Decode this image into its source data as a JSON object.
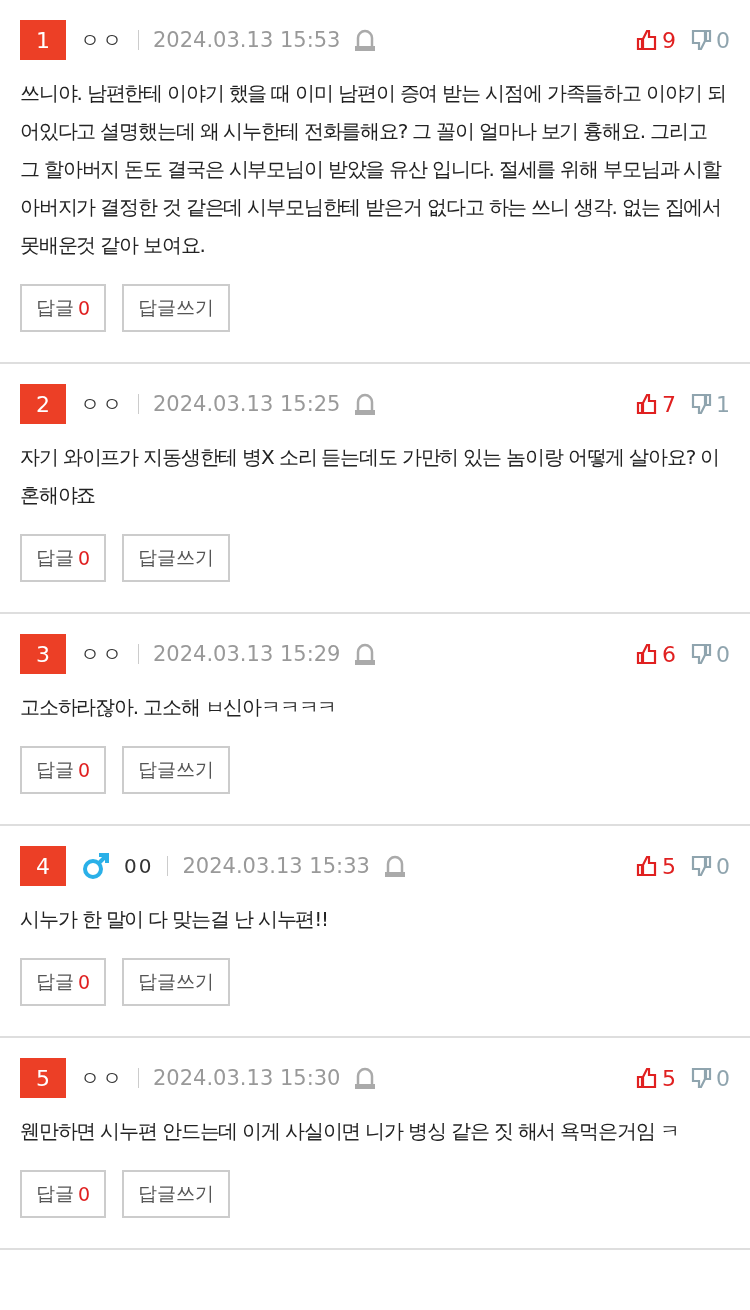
{
  "comments": [
    {
      "rank": "1",
      "author": "ㅇㅇ",
      "kind": "plain",
      "date": "2024.03.13 15:53",
      "likes": "9",
      "dislikes": "0",
      "body": "쓰니야. 남편한테 이야기 했을 때 이미 남편이 증여 받는 시점에 가족들하고 이야기 되어있다고 셜명했는데 왜 시누한테 전화를해요? 그 꼴이 얼마나 보기 흉해요. 그리고 그 할아버지 돈도 결국은 시부모님이 받았을 유산 입니다. 절세를 위해 부모님과 시할아버지가 결정한 것 같은데 시부모님한테 받은거 없다고 하는 쓰니 생각. 없는 집에서 못배운것 같아 보여요.",
      "reply_label": "답글",
      "reply_count": "0",
      "write_label": "답글쓰기"
    },
    {
      "rank": "2",
      "author": "ㅇㅇ",
      "kind": "plain",
      "date": "2024.03.13 15:25",
      "likes": "7",
      "dislikes": "1",
      "body": "자기 와이프가 지동생한테 병X 소리 듣는데도 가만히 있는 놈이랑 어떻게 살아요? 이혼해야죠",
      "reply_label": "답글",
      "reply_count": "0",
      "write_label": "답글쓰기"
    },
    {
      "rank": "3",
      "author": "ㅇㅇ",
      "kind": "plain",
      "date": "2024.03.13 15:29",
      "likes": "6",
      "dislikes": "0",
      "body": "고소하라잖아. 고소해 ㅂ신아ㅋㅋㅋㅋ",
      "reply_label": "답글",
      "reply_count": "0",
      "write_label": "답글쓰기"
    },
    {
      "rank": "4",
      "author": "00",
      "kind": "male",
      "date": "2024.03.13 15:33",
      "likes": "5",
      "dislikes": "0",
      "body": "시누가 한 말이 다 맞는걸 난 시누편!!",
      "reply_label": "답글",
      "reply_count": "0",
      "write_label": "답글쓰기"
    },
    {
      "rank": "5",
      "author": "ㅇㅇ",
      "kind": "plain",
      "date": "2024.03.13 15:30",
      "likes": "5",
      "dislikes": "0",
      "body": "웬만하면 시누편 안드는데 이게 사실이면 니가 병싱 같은 짓 해서 욕먹은거임 ㅋ",
      "reply_label": "답글",
      "reply_count": "0",
      "write_label": "답글쓰기"
    }
  ]
}
